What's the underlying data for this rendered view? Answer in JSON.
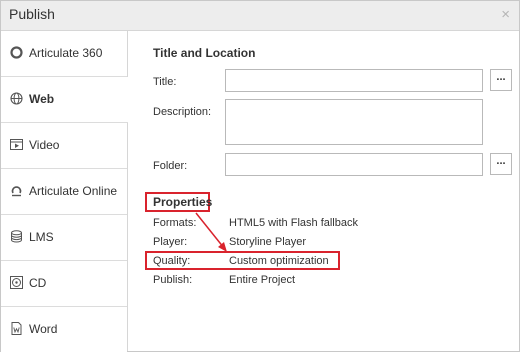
{
  "dialog": {
    "title": "Publish",
    "close_glyph": "×"
  },
  "sidebar": {
    "items": [
      {
        "label": "Articulate 360",
        "icon": "articulate-360-icon",
        "active": false
      },
      {
        "label": "Web",
        "icon": "web-globe-icon",
        "active": true
      },
      {
        "label": "Video",
        "icon": "video-icon",
        "active": false
      },
      {
        "label": "Articulate Online",
        "icon": "articulate-online-icon",
        "active": false
      },
      {
        "label": "LMS",
        "icon": "lms-database-icon",
        "active": false
      },
      {
        "label": "CD",
        "icon": "cd-disc-icon",
        "active": false
      },
      {
        "label": "Word",
        "icon": "word-document-icon",
        "active": false
      }
    ]
  },
  "title_location": {
    "heading": "Title and Location",
    "title_label": "Title:",
    "title_value": "",
    "description_label": "Description:",
    "description_value": "",
    "folder_label": "Folder:",
    "folder_value": "",
    "browse_label": "..."
  },
  "properties": {
    "heading": "Properties",
    "rows": [
      {
        "label": "Formats:",
        "value": "HTML5 with Flash fallback"
      },
      {
        "label": "Player:",
        "value": "Storyline Player"
      },
      {
        "label": "Quality:",
        "value": "Custom optimization"
      },
      {
        "label": "Publish:",
        "value": "Entire Project"
      }
    ]
  },
  "colors": {
    "highlight": "#d9232d",
    "titlebar": "#ededed",
    "border": "#b9b9b9"
  }
}
